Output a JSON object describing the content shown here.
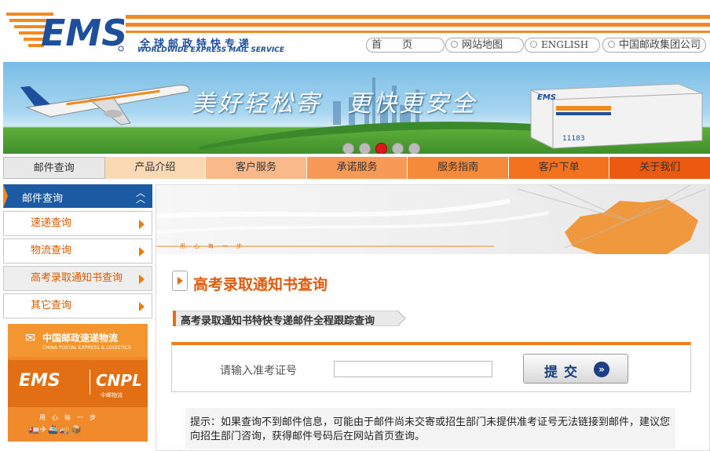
{
  "header": {
    "logo_text": "EMS",
    "tagline_cn": "全球邮政特快专递",
    "tagline_en": "WORLDWIDE EXPRESS MAIL SERVICE",
    "links": [
      "首　　页",
      "网站地图",
      "ENGLISH",
      "中国邮政集团公司"
    ]
  },
  "banner": {
    "slogan": "美好轻松寄　更快更安全",
    "box_label": "EMS",
    "box_number": "11183",
    "active_slide": 3,
    "slide_count": 5
  },
  "nav": {
    "items": [
      {
        "label": "邮件查询",
        "color": "#e8e8e8"
      },
      {
        "label": "产品介绍",
        "color": "#fbd9b5"
      },
      {
        "label": "客户服务",
        "color": "#f9b98a"
      },
      {
        "label": "承诺服务",
        "color": "#f79a58"
      },
      {
        "label": "服务指南",
        "color": "#f58a3a"
      },
      {
        "label": "客户下单",
        "color": "#f3721f"
      },
      {
        "label": "关于我们",
        "color": "#ec5a12"
      }
    ]
  },
  "sidebar": {
    "header": "邮件查询",
    "items": [
      "速递查询",
      "物流查询",
      "高考录取通知书查询",
      "其它查询"
    ],
    "promo": {
      "title_cn": "中国邮政速递物流",
      "title_en": "CHINA POSTAL EXPRESS & LOGISTICS",
      "brand1": "EMS",
      "brand2": "CNPL",
      "brand2_sub": "中邮物流",
      "slogan": "用　心　每　一　步"
    }
  },
  "main": {
    "banner_slogan": "用　心　每　一　步",
    "title": "高考录取通知书查询",
    "subtitle": "高考录取通知书特快专递邮件全程跟踪查询",
    "field_label": "请输入准考证号",
    "input_value": "",
    "submit_label": "提交",
    "note": "提示：如果查询不到邮件信息，可能由于邮件尚未交寄或招生部门未提供准考证号无法链接到邮件，建议您向招生部门咨询，获得邮件号码后在网站首页查询。"
  },
  "colors": {
    "brand_orange": "#f08a1e",
    "brand_blue": "#1c5ba4",
    "title_orange": "#e25a0b"
  }
}
